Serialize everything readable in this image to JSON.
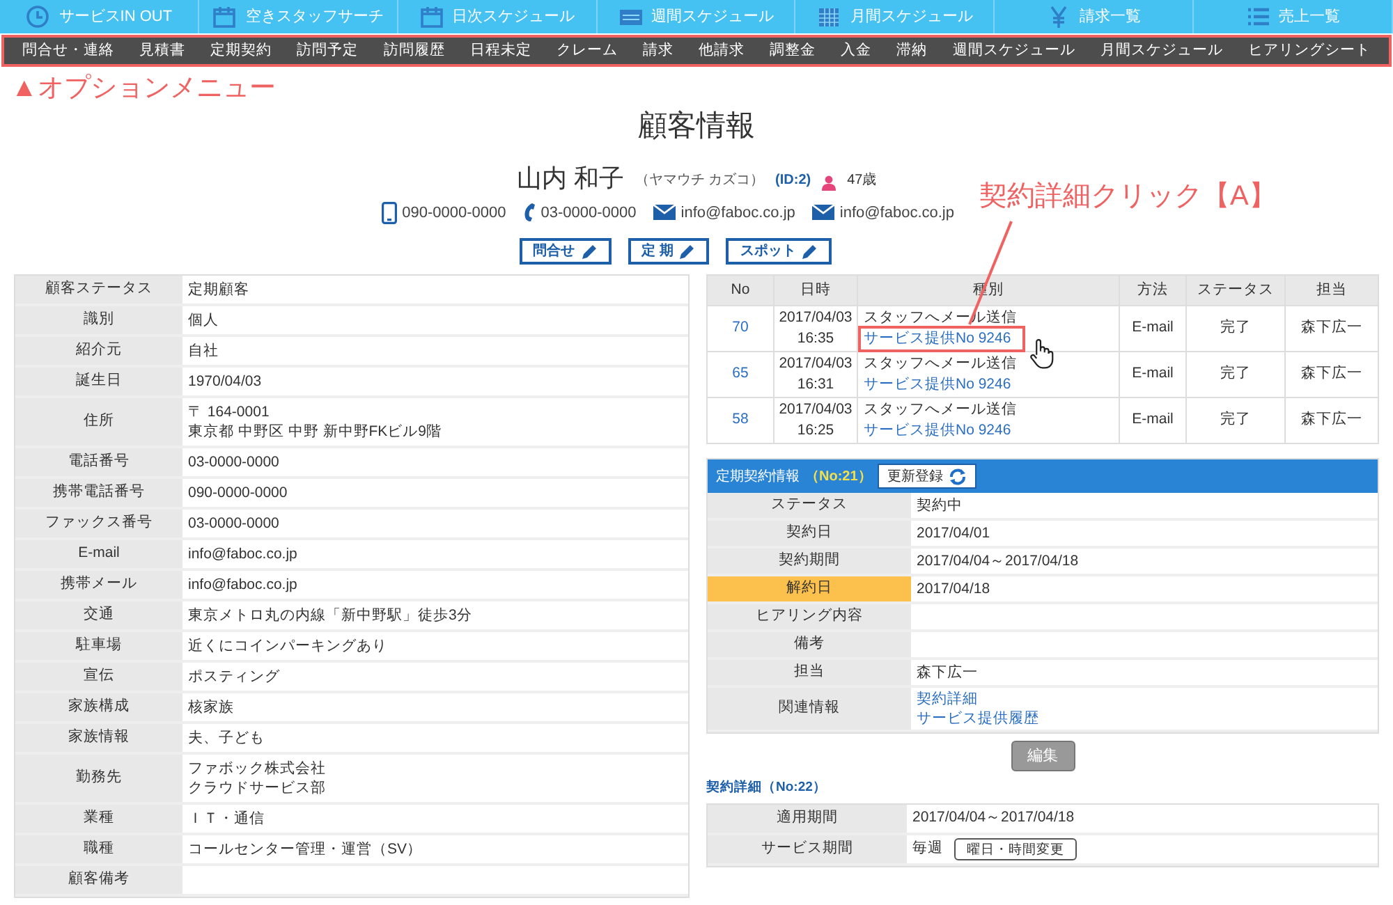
{
  "top_nav": [
    "サービスIN OUT",
    "空きスタッフサーチ",
    "日次スケジュール",
    "週間スケジュール",
    "月間スケジュール",
    "請求一覧",
    "売上一覧"
  ],
  "option_menu": [
    "問合せ・連絡",
    "見積書",
    "定期契約",
    "訪問予定",
    "訪問履歴",
    "日程未定",
    "クレーム",
    "請求",
    "他請求",
    "調整金",
    "入金",
    "滞納",
    "週間スケジュール",
    "月間スケジュール",
    "ヒアリングシート"
  ],
  "option_menu_label": "▲オプションメニュー",
  "title": "顧客情報",
  "customer": {
    "name": "山内 和子",
    "kana": "（ヤマウチ カズコ）",
    "id": "(ID:2)",
    "age": "47歳",
    "mobile": "090-0000-0000",
    "phone": "03-0000-0000",
    "email": "info@faboc.co.jp",
    "mobile_email": "info@faboc.co.jp"
  },
  "action_buttons": [
    "問合せ",
    "定 期",
    "スポット"
  ],
  "customer_table": [
    {
      "label": "顧客ステータス",
      "lines": [
        "定期顧客"
      ]
    },
    {
      "label": "識別",
      "lines": [
        "個人"
      ]
    },
    {
      "label": "紹介元",
      "lines": [
        "自社"
      ]
    },
    {
      "label": "誕生日",
      "lines": [
        "1970/04/03"
      ]
    },
    {
      "label": "住所",
      "lines": [
        "〒 164-0001",
        "東京都 中野区 中野 新中野FKビル9階"
      ]
    },
    {
      "label": "電話番号",
      "lines": [
        "03-0000-0000"
      ]
    },
    {
      "label": "携帯電話番号",
      "lines": [
        "090-0000-0000"
      ]
    },
    {
      "label": "ファックス番号",
      "lines": [
        "03-0000-0000"
      ]
    },
    {
      "label": "E-mail",
      "lines": [
        "info@faboc.co.jp"
      ]
    },
    {
      "label": "携帯メール",
      "lines": [
        "info@faboc.co.jp"
      ]
    },
    {
      "label": "交通",
      "lines": [
        "東京メトロ丸の内線「新中野駅」徒歩3分"
      ]
    },
    {
      "label": "駐車場",
      "lines": [
        "近くにコインパーキングあり"
      ]
    },
    {
      "label": "宣伝",
      "lines": [
        "ポスティング"
      ]
    },
    {
      "label": "家族構成",
      "lines": [
        "核家族"
      ]
    },
    {
      "label": "家族情報",
      "lines": [
        "夫、子ども"
      ]
    },
    {
      "label": "勤務先",
      "lines": [
        "ファボック株式会社",
        "クラウドサービス部"
      ]
    },
    {
      "label": "業種",
      "lines": [
        "ＩＴ・通信"
      ]
    },
    {
      "label": "職種",
      "lines": [
        "コールセンター管理・運営（SV）"
      ]
    },
    {
      "label": "顧客備考"
    }
  ],
  "history": {
    "columns": [
      "No",
      "日時",
      "種別",
      "方法",
      "ステータス",
      "担当"
    ],
    "rows": [
      {
        "no": "70",
        "date": "2017/04/03",
        "time": "16:35",
        "type": "スタッフへメール送信",
        "link": "サービス提供No 9246",
        "method": "E-mail",
        "status": "完了",
        "staff": "森下広一",
        "highlighted": true
      },
      {
        "no": "65",
        "date": "2017/04/03",
        "time": "16:31",
        "type": "スタッフへメール送信",
        "link": "サービス提供No 9246",
        "method": "E-mail",
        "status": "完了",
        "staff": "森下広一",
        "highlighted": false
      },
      {
        "no": "58",
        "date": "2017/04/03",
        "time": "16:25",
        "type": "スタッフへメール送信",
        "link": "サービス提供No 9246",
        "method": "E-mail",
        "status": "完了",
        "staff": "森下広一",
        "highlighted": false
      }
    ]
  },
  "contract": {
    "title": "定期契約情報",
    "number": "（No:21）",
    "renew_button": "更新登録",
    "rows": [
      {
        "label": "ステータス",
        "kind": "text",
        "lines": [
          "契約中"
        ],
        "alert": false
      },
      {
        "label": "契約日",
        "kind": "text",
        "lines": [
          "2017/04/01"
        ],
        "alert": false
      },
      {
        "label": "契約期間",
        "kind": "text",
        "lines": [
          "2017/04/04～2017/04/18"
        ],
        "alert": false
      },
      {
        "label": "解約日",
        "kind": "text",
        "lines": [
          "2017/04/18"
        ],
        "alert": true
      },
      {
        "label": "ヒアリング内容",
        "alert": false
      },
      {
        "label": "備考",
        "alert": false
      },
      {
        "label": "担当",
        "kind": "text",
        "lines": [
          "森下広一"
        ],
        "alert": false
      },
      {
        "label": "関連情報",
        "kind": "links",
        "lines": [
          "契約詳細",
          "サービス提供履歴"
        ],
        "alert": false
      }
    ],
    "edit_button": "編集"
  },
  "detail": {
    "title": "契約詳細（No:22）",
    "rows": [
      {
        "label": "適用期間",
        "value": "2017/04/04～2017/04/18"
      },
      {
        "label": "サービス期間",
        "value": "毎週",
        "button": "曜日・時間変更"
      }
    ]
  },
  "annotation": "契約詳細クリック【A】"
}
